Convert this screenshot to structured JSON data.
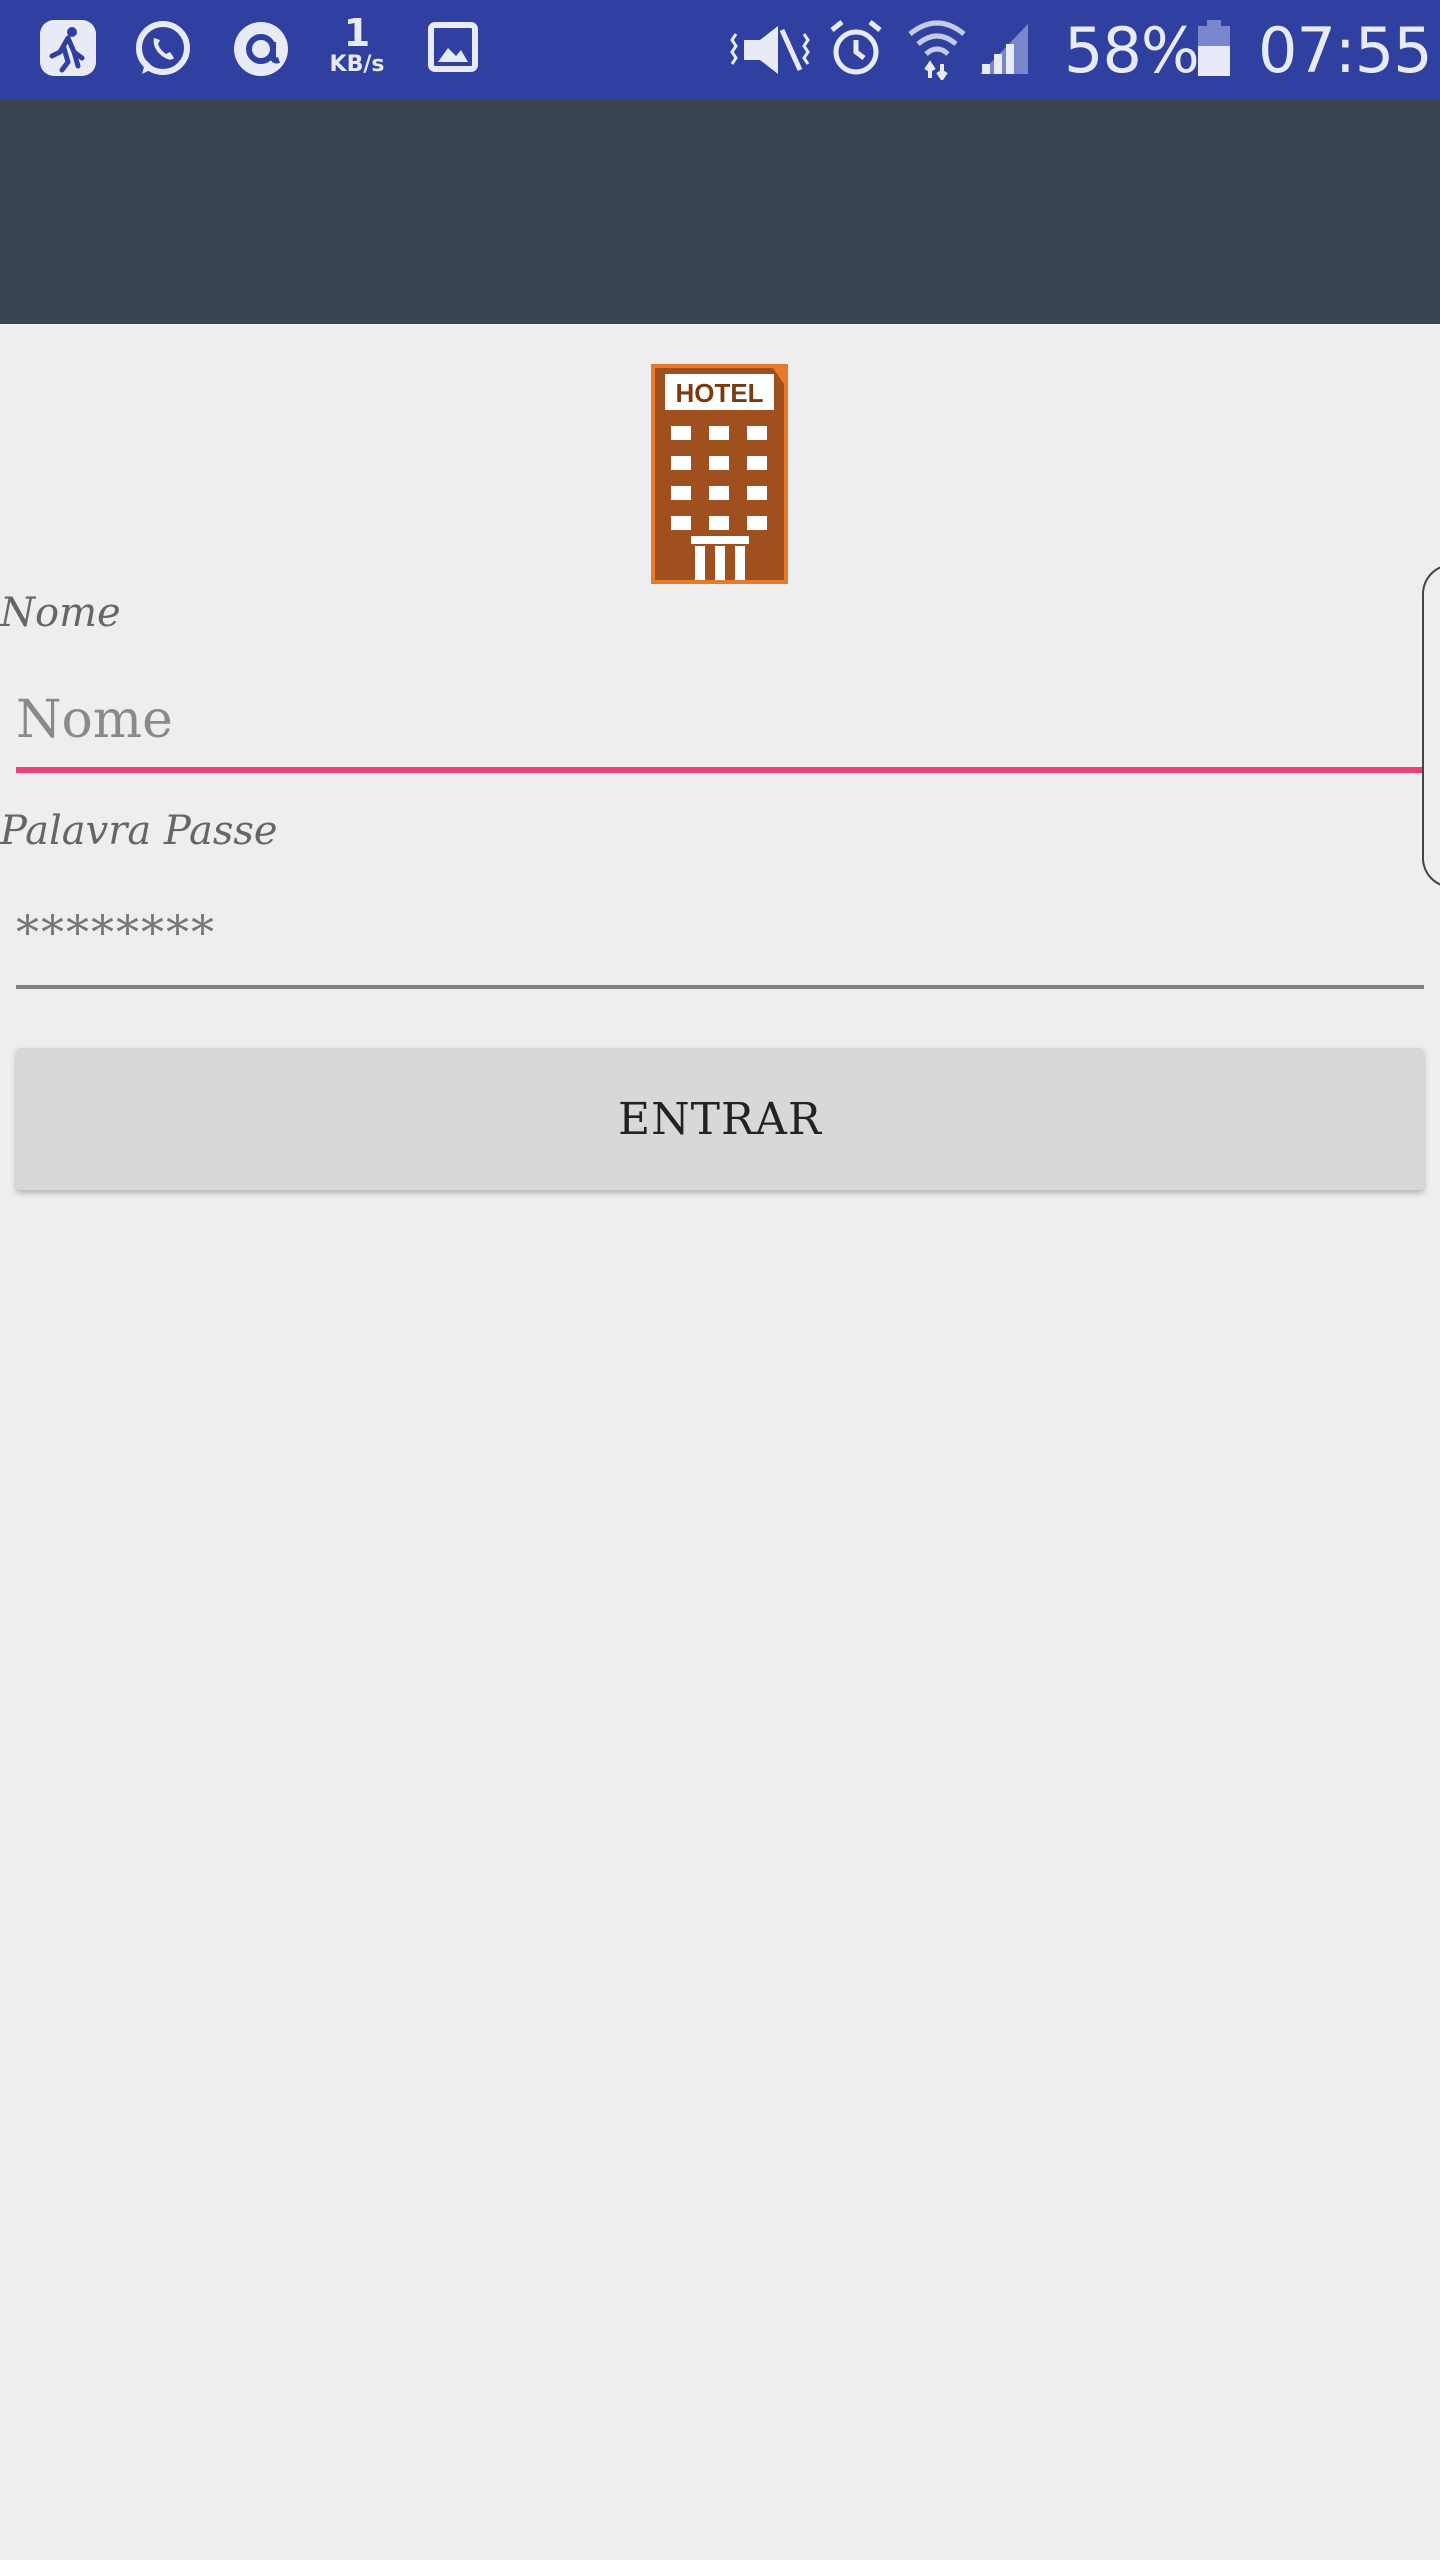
{
  "status_bar": {
    "icons_left": [
      "runner-app-icon",
      "whatsapp-icon",
      "at-sign-icon",
      "gallery-icon"
    ],
    "net_speed_value": "1",
    "net_speed_unit": "KB/s",
    "icons_right": [
      "vibrate-mute-icon",
      "alarm-icon",
      "wifi-icon",
      "signal-icon",
      "battery-icon"
    ],
    "battery_percent": "58%",
    "time": "07:55",
    "color": "#3040a0"
  },
  "app_bar": {
    "color": "#394550"
  },
  "logo": {
    "text": "HOTEL",
    "icon": "hotel-building-icon"
  },
  "form": {
    "name_label": "Nome",
    "name_placeholder": "Nome",
    "password_label": "Palavra Passe",
    "password_value": "********",
    "submit_label": "ENTRAR",
    "accent_color": "#ec407a"
  }
}
